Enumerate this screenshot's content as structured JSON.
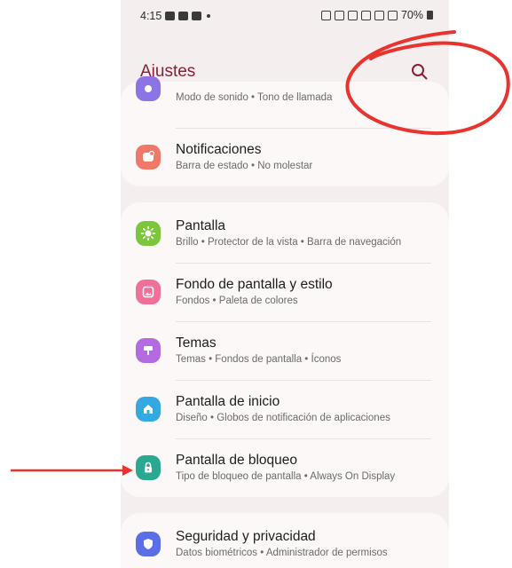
{
  "status_bar": {
    "time": "4:15",
    "battery": "70%"
  },
  "header": {
    "title": "Ajustes",
    "search_icon": "search-icon"
  },
  "settings": {
    "sonido": {
      "subtitle": "Modo de sonido  •  Tono de llamada",
      "icon": "sound-icon",
      "color": "#8c73e6"
    },
    "notificaciones": {
      "title": "Notificaciones",
      "subtitle": "Barra de estado  •  No molestar",
      "icon": "notification-icon",
      "color": "#f07868"
    },
    "pantalla": {
      "title": "Pantalla",
      "subtitle": "Brillo  •  Protector de la vista  •  Barra de navegación",
      "icon": "brightness-icon",
      "color": "#7cc63c"
    },
    "fondo": {
      "title": "Fondo de pantalla y estilo",
      "subtitle": "Fondos  •  Paleta de colores",
      "icon": "wallpaper-icon",
      "color": "#f0709a"
    },
    "temas": {
      "title": "Temas",
      "subtitle": "Temas  •  Fondos de pantalla  •  Íconos",
      "icon": "themes-icon",
      "color": "#b46ae0"
    },
    "inicio": {
      "title": "Pantalla de inicio",
      "subtitle": "Diseño  •  Globos de notificación de aplicaciones",
      "icon": "home-icon",
      "color": "#34a8e0"
    },
    "bloqueo": {
      "title": "Pantalla de bloqueo",
      "subtitle": "Tipo de bloqueo de pantalla  •  Always On Display",
      "icon": "lock-icon",
      "color": "#2aa890"
    },
    "seguridad": {
      "title": "Seguridad y privacidad",
      "subtitle": "Datos biométricos  •  Administrador de permisos",
      "icon": "shield-icon",
      "color": "#5a6ee6"
    }
  },
  "annotations": {
    "circle_color": "#e8332e",
    "arrow_color": "#e8332e"
  }
}
